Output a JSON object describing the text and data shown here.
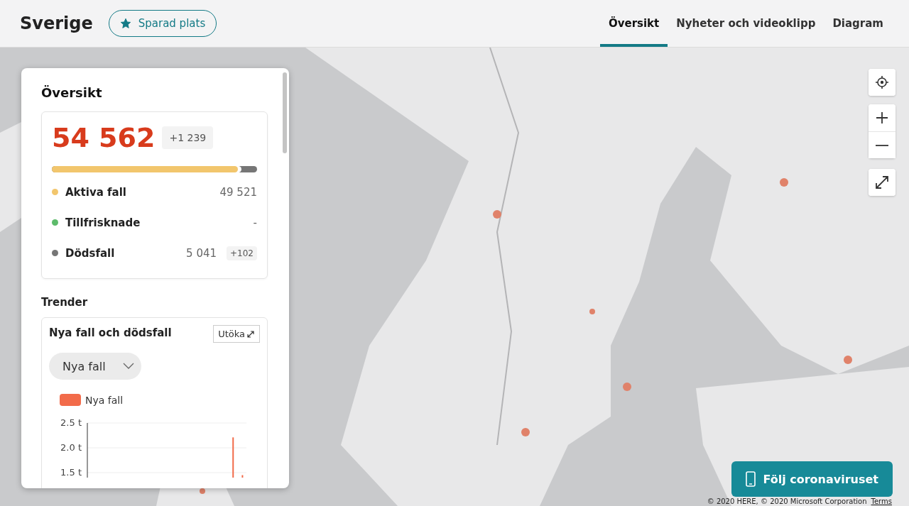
{
  "header": {
    "title": "Sverige",
    "saved_button": {
      "label": "Sparad plats",
      "selected": true
    }
  },
  "tabs": [
    {
      "label": "Översikt",
      "selected": true
    },
    {
      "label": "Nyheter och videoklipp",
      "selected": false
    },
    {
      "label": "Diagram",
      "selected": false
    }
  ],
  "overview": {
    "title": "Översikt",
    "total": "54 562",
    "total_change": "+1 239",
    "bar": {
      "level": 0.908
    },
    "rows": [
      {
        "label": "Aktiva fall",
        "value": "49 521",
        "color": "#f2c66d"
      },
      {
        "label": "Tillfrisknade",
        "value": "-",
        "color": "#5dbb6b"
      },
      {
        "label": "Dödsfall",
        "value": "5 041",
        "change": "+102",
        "color": "#767676"
      }
    ]
  },
  "trends": {
    "title": "Trender",
    "card_title": "Nya fall och dödsfall",
    "expand_button": "Utöka",
    "dropdown": {
      "value": "Nya fall"
    },
    "chart_data": {
      "type": "bar",
      "grid": true,
      "ylim": [
        1.4,
        2.5
      ],
      "yticks": [
        {
          "value": 2.5,
          "label": "2.5 t"
        },
        {
          "value": 2.0,
          "label": "2.0 t"
        },
        {
          "value": 1.5,
          "label": "1.5 t"
        }
      ],
      "series": [
        {
          "name": "Nya fall",
          "color": "#f26b4a",
          "values": [
            null,
            null,
            null,
            null,
            null,
            null,
            null,
            null,
            null,
            null,
            null,
            null,
            null,
            null,
            null,
            2.21,
            1.45
          ]
        }
      ]
    }
  },
  "follow_button": "Följ coronaviruset",
  "attribution": {
    "text": "© 2020 HERE, © 2020 Microsoft Corporation",
    "link": "Terms"
  }
}
